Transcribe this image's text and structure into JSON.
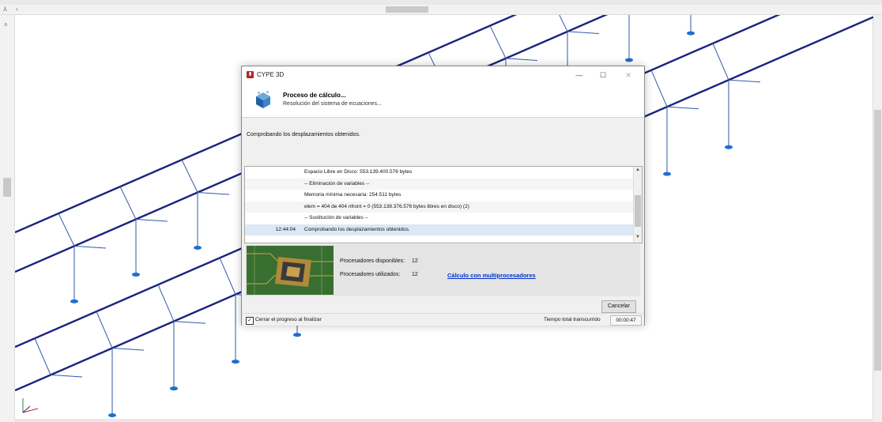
{
  "window": {
    "title": "CYPE 3D"
  },
  "dialog": {
    "heading": "Proceso de cálculo...",
    "subheading": "Resolución del sistema de ecuaciones...",
    "status": "Comprobando los desplazamientos obtenidos.",
    "log": [
      {
        "time": "",
        "text": "Espacio Libre en Disco: 553.139.400.576 bytes"
      },
      {
        "time": "",
        "text": "-- Eliminación de variables --"
      },
      {
        "time": "",
        "text": "Memoria mínima necesaria: 254.511 bytes"
      },
      {
        "time": "",
        "text": "elem = 404 de 404 nfront = 0 (553.138.376.576 bytes libres en disco) (2)"
      },
      {
        "time": "",
        "text": "-- Sustitución de variables --"
      },
      {
        "time": "12:44:04",
        "text": "Comprobando los desplazamientos obtenidos."
      }
    ],
    "processors": {
      "available_label": "Procesadores disponibles:",
      "available_value": "12",
      "used_label": "Procesadores utilizados:",
      "used_value": "12",
      "link": "Cálculo con multiprocesadores"
    },
    "cancel_button": "Cancelar",
    "close_checkbox": {
      "label": "Cerrar el progreso al finalizar",
      "checked": true
    },
    "total_time_label": "Tiempo total transcurrido",
    "total_time_value": "00:00:47"
  },
  "viewport": {
    "structure_color": "#1a237e",
    "column_color": "#2f5aa8",
    "support_color": "#1e6fd0"
  },
  "icons": [
    "app-icon",
    "calc-cube-icon",
    "minimize-icon",
    "maximize-icon",
    "close-icon",
    "checkbox-checked-icon",
    "cpu-chip-image",
    "axes-icon"
  ]
}
